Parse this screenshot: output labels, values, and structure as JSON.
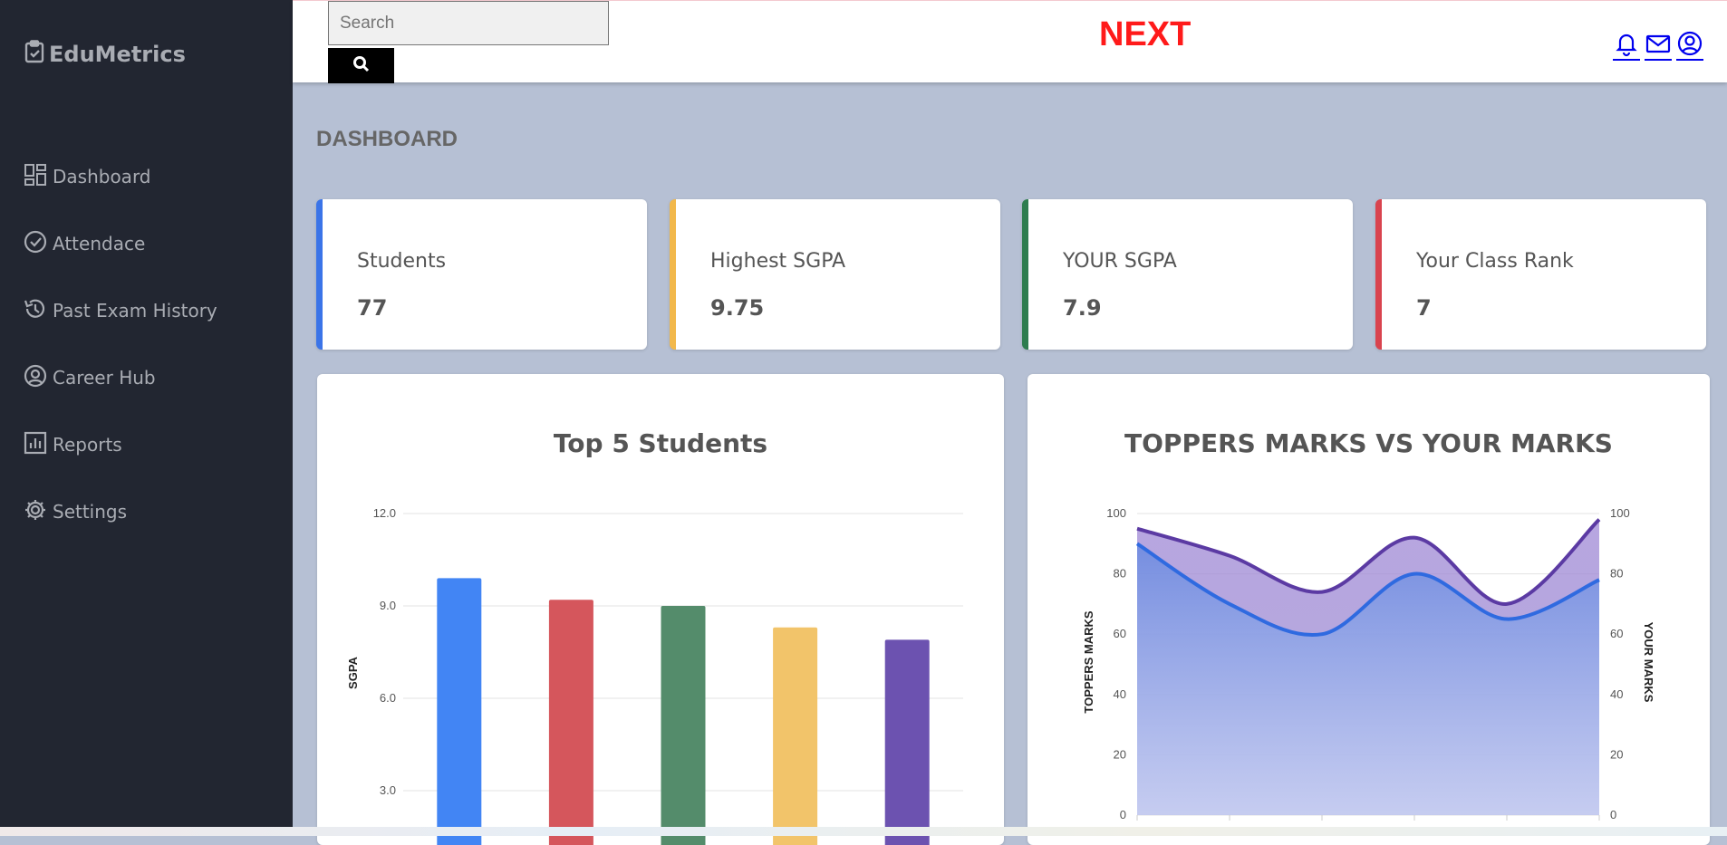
{
  "sidebar": {
    "brand": "EduMetrics",
    "items": [
      {
        "label": "Dashboard",
        "icon": "dashboard-icon"
      },
      {
        "label": "Attendace",
        "icon": "check-circle-icon"
      },
      {
        "label": "Past Exam History",
        "icon": "history-icon"
      },
      {
        "label": "Career Hub",
        "icon": "user-circle-icon"
      },
      {
        "label": "Reports",
        "icon": "bar-chart-icon"
      },
      {
        "label": "Settings",
        "icon": "gear-icon"
      }
    ]
  },
  "topbar": {
    "search_placeholder": "Search",
    "center_text": "NEXT",
    "icons": [
      "bell-icon",
      "mail-icon",
      "user-circle-icon"
    ]
  },
  "page_title": "DASHBOARD",
  "cards": [
    {
      "label": "Students",
      "value": "77",
      "accent": "#3b74e8"
    },
    {
      "label": "Highest SGPA",
      "value": "9.75",
      "accent": "#f2b84b"
    },
    {
      "label": "YOUR SGPA",
      "value": "7.9",
      "accent": "#2e7d4f"
    },
    {
      "label": "Your Class Rank",
      "value": "7",
      "accent": "#d9434e"
    }
  ],
  "chart_data": [
    {
      "type": "bar",
      "title": "Top 5 Students",
      "ylabel": "SGPA",
      "xlabel": "",
      "ylim": [
        0,
        12
      ],
      "yticks": [
        "3.0",
        "6.0",
        "9.0",
        "12.0"
      ],
      "values": [
        9.9,
        9.2,
        9.0,
        8.3,
        7.9
      ],
      "colors": [
        "#4285f4",
        "#d5565c",
        "#548c6b",
        "#f2c46a",
        "#6c52b0"
      ],
      "grid": true
    },
    {
      "type": "area",
      "title": "TOPPERS MARKS VS YOUR MARKS",
      "ylabel_left": "TOPPERS MARKS",
      "ylabel_right": "YOUR MARKS",
      "ylim": [
        0,
        100
      ],
      "yticks": [
        "0",
        "20",
        "40",
        "60",
        "80",
        "100"
      ],
      "series": [
        {
          "values": [
            95,
            86,
            74,
            92,
            70,
            98
          ],
          "color": "#5b3aa3"
        },
        {
          "values": [
            90,
            70,
            60,
            80,
            65,
            78
          ],
          "color": "#2f6ae0"
        }
      ],
      "grid": true
    }
  ]
}
